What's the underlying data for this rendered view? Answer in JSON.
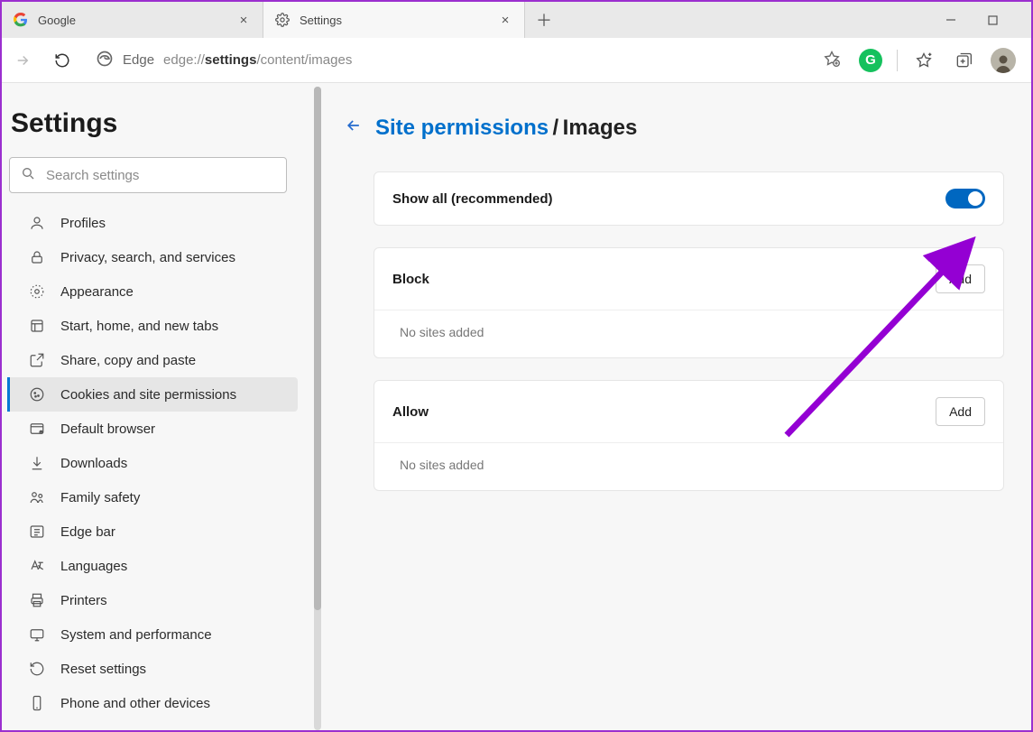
{
  "tabs": [
    {
      "title": "Google",
      "favicon": "google"
    },
    {
      "title": "Settings",
      "favicon": "gear"
    }
  ],
  "toolbar": {
    "edge_label": "Edge",
    "url_prefix": "edge://",
    "url_bold": "settings",
    "url_rest": "/content/images"
  },
  "sidebar": {
    "heading": "Settings",
    "search_placeholder": "Search settings",
    "items": [
      {
        "icon": "profile",
        "label": "Profiles"
      },
      {
        "icon": "lock",
        "label": "Privacy, search, and services"
      },
      {
        "icon": "appearance",
        "label": "Appearance"
      },
      {
        "icon": "start",
        "label": "Start, home, and new tabs"
      },
      {
        "icon": "share",
        "label": "Share, copy and paste"
      },
      {
        "icon": "cookie",
        "label": "Cookies and site permissions"
      },
      {
        "icon": "browser",
        "label": "Default browser"
      },
      {
        "icon": "download",
        "label": "Downloads"
      },
      {
        "icon": "family",
        "label": "Family safety"
      },
      {
        "icon": "edgebar",
        "label": "Edge bar"
      },
      {
        "icon": "lang",
        "label": "Languages"
      },
      {
        "icon": "printer",
        "label": "Printers"
      },
      {
        "icon": "system",
        "label": "System and performance"
      },
      {
        "icon": "reset",
        "label": "Reset settings"
      },
      {
        "icon": "phone",
        "label": "Phone and other devices"
      }
    ],
    "active_index": 5
  },
  "breadcrumb": {
    "link": "Site permissions",
    "separator": "/",
    "current": "Images"
  },
  "panel": {
    "show_all": {
      "label": "Show all (recommended)",
      "on": true
    },
    "block": {
      "label": "Block",
      "button": "Add",
      "empty": "No sites added"
    },
    "allow": {
      "label": "Allow",
      "button": "Add",
      "empty": "No sites added"
    }
  }
}
